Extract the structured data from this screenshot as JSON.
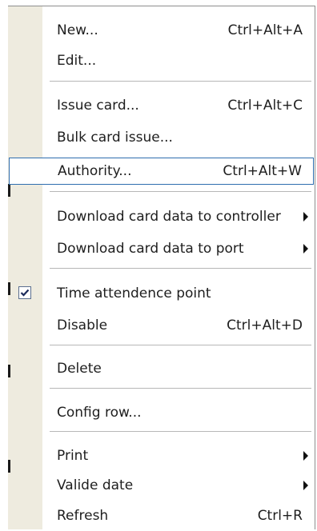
{
  "context_menu": {
    "items": [
      {
        "label": "New...",
        "shortcut": "Ctrl+Alt+A"
      },
      {
        "label": "Edit...",
        "shortcut": ""
      },
      {
        "label": "Issue card...",
        "shortcut": "Ctrl+Alt+C"
      },
      {
        "label": "Bulk card issue...",
        "shortcut": ""
      },
      {
        "label": "Authority...",
        "shortcut": "Ctrl+Alt+W",
        "highlighted": true
      },
      {
        "label": "Download card data to controller",
        "shortcut": "",
        "submenu": true
      },
      {
        "label": "Download card data to port",
        "shortcut": "",
        "submenu": true
      },
      {
        "label": "Time attendence point",
        "shortcut": "",
        "checked": true
      },
      {
        "label": "Disable",
        "shortcut": "Ctrl+Alt+D"
      },
      {
        "label": "Delete",
        "shortcut": ""
      },
      {
        "label": "Config row...",
        "shortcut": ""
      },
      {
        "label": "Print",
        "shortcut": "",
        "submenu": true
      },
      {
        "label": "Valide date",
        "shortcut": "",
        "submenu": true
      },
      {
        "label": "Refresh",
        "shortcut": "Ctrl+R"
      }
    ]
  },
  "colors": {
    "gutter": "#eeebdf",
    "highlight_border": "#2f6eaf",
    "separator": "#b7b7b7"
  },
  "icons": {
    "check": "check-icon",
    "submenu": "submenu-arrow-icon"
  }
}
